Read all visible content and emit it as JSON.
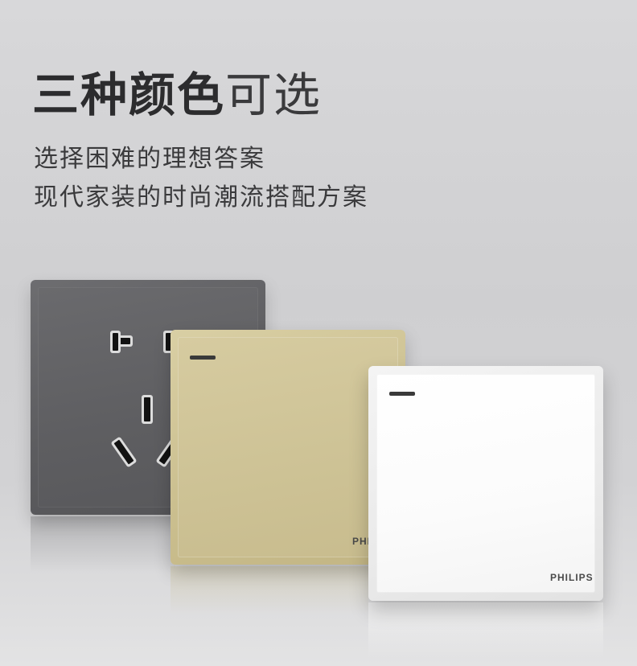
{
  "headline": {
    "bold_part": "三种颜色",
    "light_part": "可选"
  },
  "subtitle": {
    "line1": "选择困难的理想答案",
    "line2": "现代家装的时尚潮流搭配方案"
  },
  "products": [
    {
      "type": "socket",
      "finish": "grey",
      "color": "#5f5f62"
    },
    {
      "type": "switch",
      "finish": "gold",
      "color": "#cdc295",
      "brand": "PHILIPS"
    },
    {
      "type": "switch",
      "finish": "white",
      "color": "#f8f8f8",
      "brand": "PHILIPS"
    }
  ]
}
